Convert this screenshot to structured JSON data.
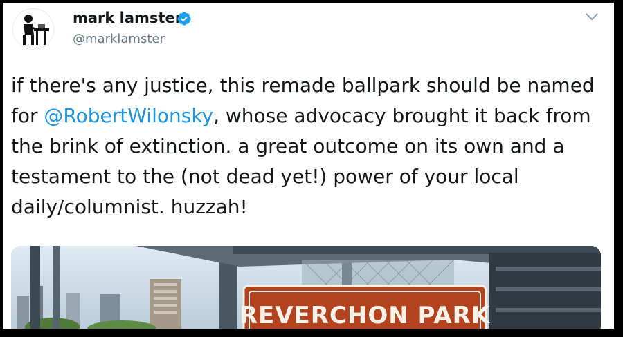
{
  "tweet": {
    "author_name": "mark lamster",
    "author_handle": "@marklamster",
    "text_before": "if there's any justice, this remade ballpark should be named for ",
    "mention": "@RobertWilonsky",
    "text_after": ", whose advocacy brought it back from the brink of extinction. a great outcome on its own and a testament to the (not dead yet!) power of your local daily/columnist. huzzah!"
  },
  "media": {
    "sign_text": "REVERCHON PARK"
  },
  "icons": {
    "verified": "verified-badge-icon",
    "menu": "chevron-down-icon"
  },
  "colors": {
    "link": "#1b95e0",
    "verified": "#1da1f2",
    "text": "#14171a",
    "secondary": "#657786",
    "sign_bg": "#b3431f"
  }
}
